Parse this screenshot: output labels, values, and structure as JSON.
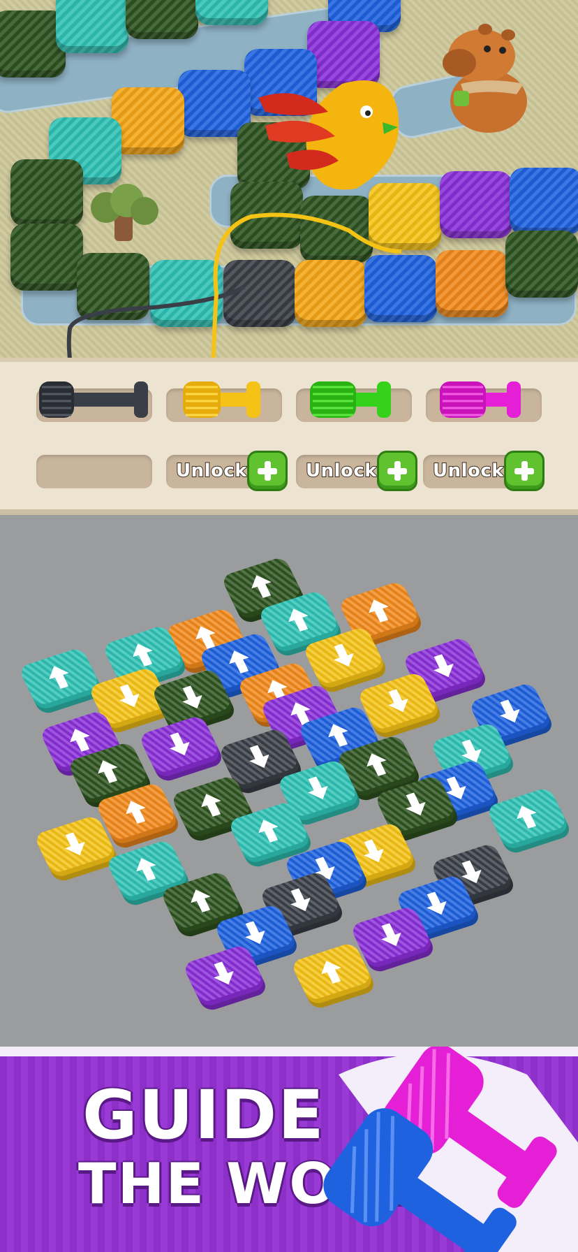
{
  "game": {
    "tube_colors": [
      "dark-gray",
      "yellow",
      "green",
      "magenta"
    ],
    "unlock_slots": [
      {
        "label": "Unlock"
      },
      {
        "label": "Unlock"
      },
      {
        "label": "Unlock"
      }
    ]
  },
  "banner": {
    "line1": "GUIDE",
    "line2": "THE WOOL"
  },
  "colors": {
    "dark_green": "#2e5420",
    "teal": "#2fc2b5",
    "orange": "#f28a1c",
    "yellow": "#f5c316",
    "blue": "#1f62e0",
    "purple": "#8a2fd9",
    "charcoal": "#3a3f47",
    "lime": "#35d21c",
    "magenta": "#e51fd5",
    "banner_purple": "#9535d1",
    "unlock_green": "#5fc22e"
  }
}
